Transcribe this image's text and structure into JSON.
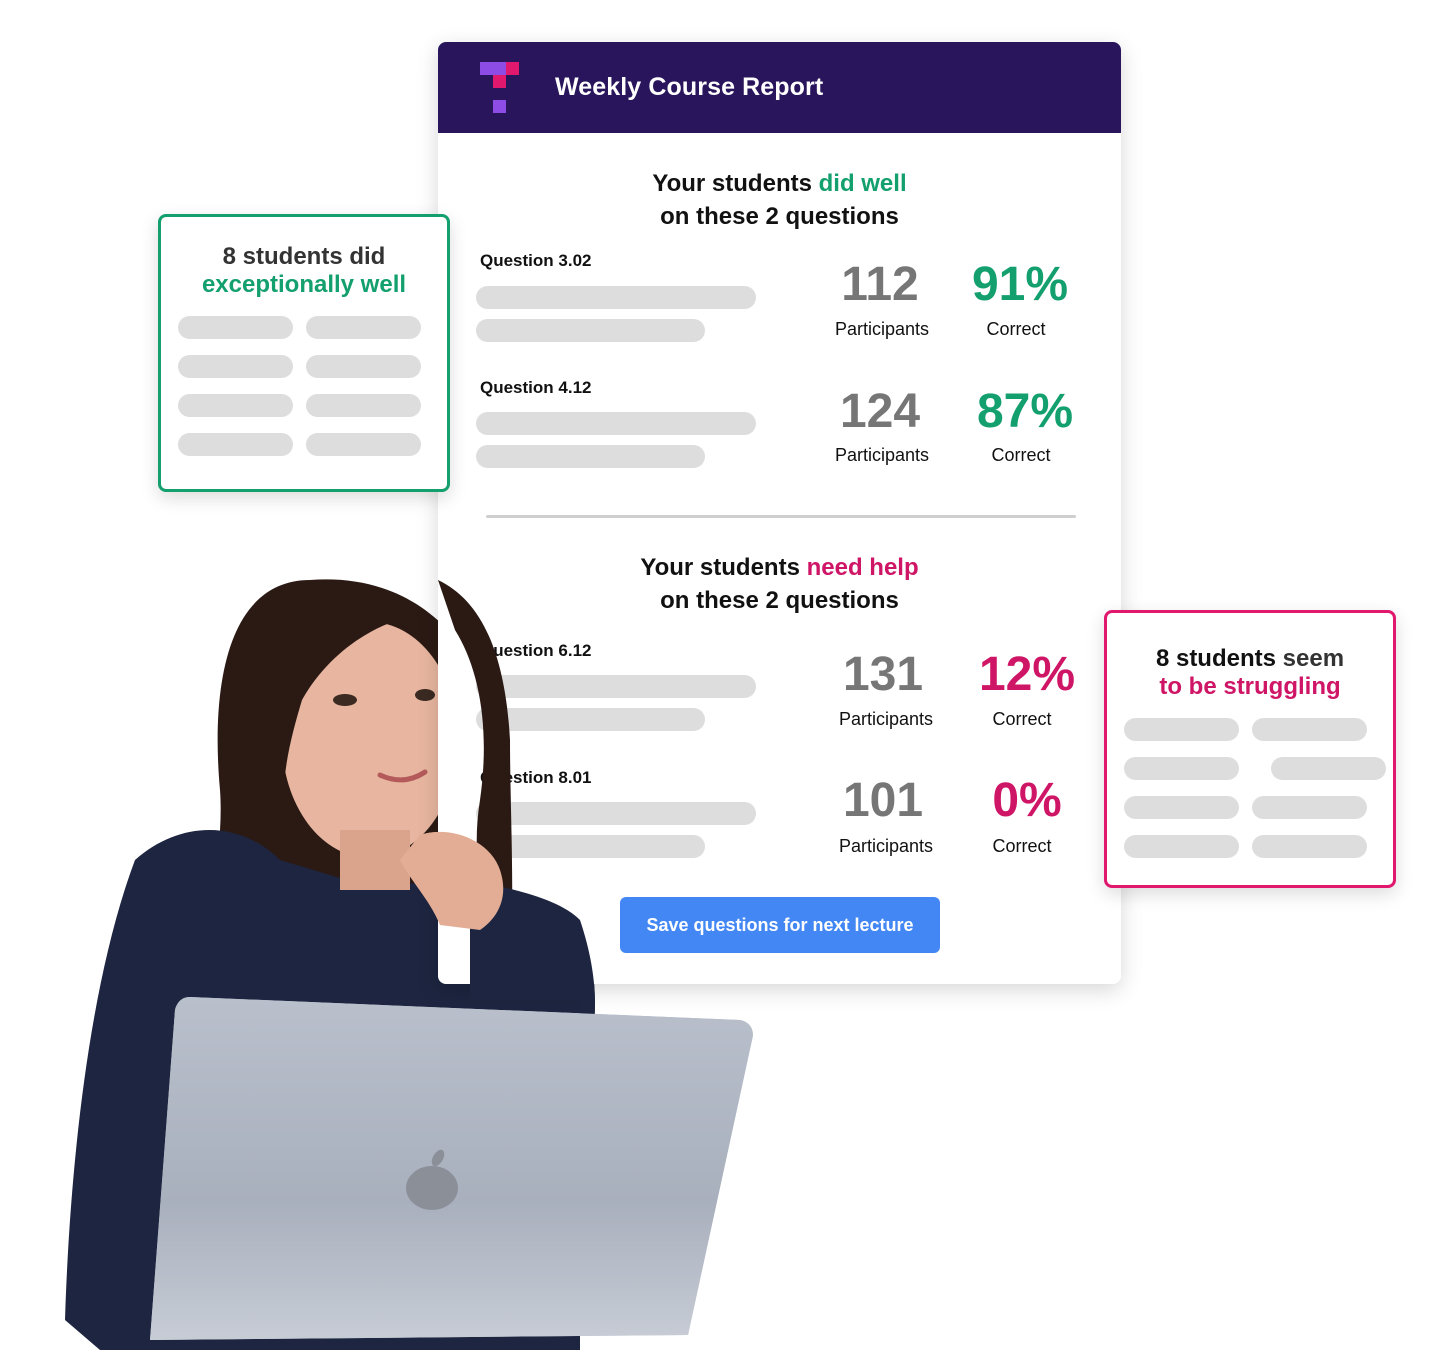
{
  "report": {
    "title": "Weekly Course Report",
    "logo": "tophat-logo-icon",
    "well_section": {
      "heading_prefix": "Your students ",
      "heading_highlight": "did well",
      "heading_line2": "on these 2 questions",
      "questions": [
        {
          "label": "Question 3.02",
          "participants": "112",
          "participants_label": "Participants",
          "correct": "91%",
          "correct_label": "Correct"
        },
        {
          "label": "Question 4.12",
          "participants": "124",
          "participants_label": "Participants",
          "correct": "87%",
          "correct_label": "Correct"
        }
      ]
    },
    "help_section": {
      "heading_prefix": "Your students ",
      "heading_highlight": "need help",
      "heading_line2": "on these 2 questions",
      "questions": [
        {
          "label": "Question 6.12",
          "participants": "131",
          "participants_label": "Participants",
          "correct": "12%",
          "correct_label": "Correct"
        },
        {
          "label": "Question 8.01",
          "participants": "101",
          "participants_label": "Participants",
          "correct": "0%",
          "correct_label": "Correct"
        }
      ]
    },
    "save_button_label": "Save questions for next lecture"
  },
  "side_cards": {
    "good": {
      "line1": "8 students did",
      "line2": "exceptionally well"
    },
    "struggling": {
      "line1_a": "8 students",
      "line1_b": " seem",
      "line2": "to be struggling"
    }
  },
  "colors": {
    "header_bg": "#29155c",
    "good": "#14a06e",
    "bad": "#cf1566",
    "button": "#4387f4",
    "participants_number": "#767676"
  },
  "illustration": {
    "subject": "woman-with-laptop-photo"
  }
}
